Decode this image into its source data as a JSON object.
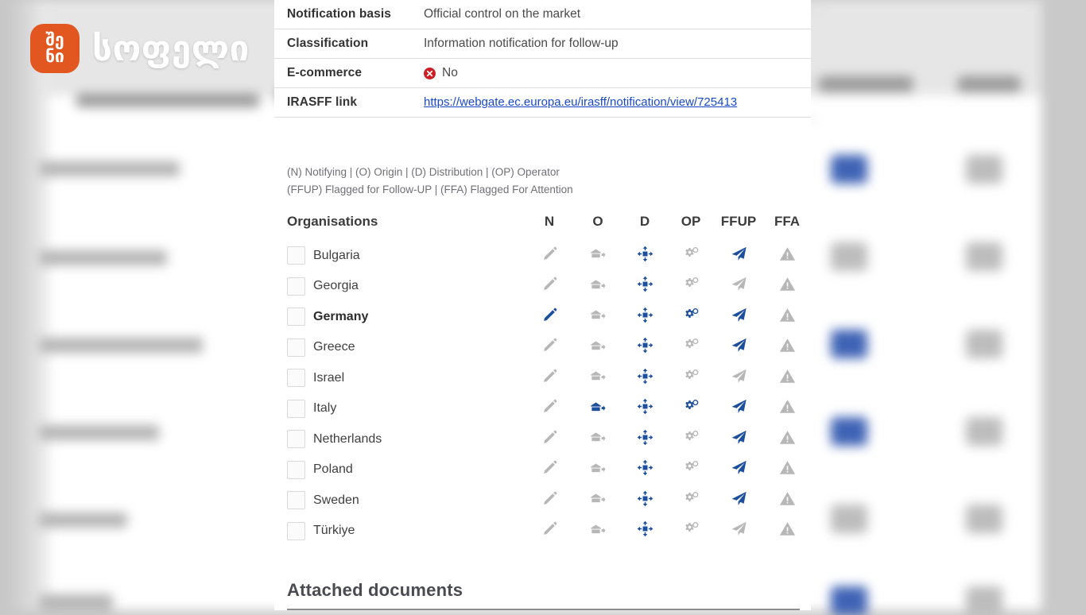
{
  "watermark": {
    "badge_line1": "შე",
    "badge_line2": "ნი",
    "wordmark": "სოფელი",
    "brand_color": "#e2561f"
  },
  "details": {
    "rows": [
      {
        "label": "Notification basis",
        "value": "Official control on the market",
        "type": "text"
      },
      {
        "label": "Classification",
        "value": "Information notification for follow-up",
        "type": "text"
      },
      {
        "label": "E-commerce",
        "value": "No",
        "type": "status-no",
        "status_color": "#cc1f26"
      },
      {
        "label": "IRASFF link",
        "value": "https://webgate.ec.europa.eu/irasff/notification/view/725413",
        "type": "link",
        "link_color": "#1749c9"
      }
    ]
  },
  "legend": {
    "line1": "(N) Notifying | (O) Origin | (D) Distribution | (OP) Operator",
    "line2": "(FFUP) Flagged for Follow-UP | (FFA) Flagged For Attention"
  },
  "organisations": {
    "headers": {
      "name": "Organisations",
      "n": "N",
      "o": "O",
      "d": "D",
      "op": "OP",
      "ffup": "FFUP",
      "ffa": "FFA"
    },
    "icon_names": {
      "n": "pencil-icon",
      "o": "warehouse-arrow-icon",
      "d": "distribution-spread-icon",
      "op": "gears-icon",
      "ffup": "paper-plane-icon",
      "ffa": "warning-triangle-icon"
    },
    "colors": {
      "active": "#1c4f9c",
      "inactive": "#b7b7b7",
      "inactive_light": "#cfcfcf"
    },
    "rows": [
      {
        "name": "Bulgaria",
        "bold": false,
        "checked": false,
        "n": "inactive",
        "o": "inactive",
        "d": "active",
        "op": "inactive",
        "ffup": "active",
        "ffa": "inactive"
      },
      {
        "name": "Georgia",
        "bold": false,
        "checked": false,
        "n": "inactive",
        "o": "inactive",
        "d": "active",
        "op": "inactive",
        "ffup": "inactive",
        "ffa": "inactive"
      },
      {
        "name": "Germany",
        "bold": true,
        "checked": false,
        "n": "active",
        "o": "inactive",
        "d": "active",
        "op": "active",
        "ffup": "active",
        "ffa": "inactive"
      },
      {
        "name": "Greece",
        "bold": false,
        "checked": false,
        "n": "inactive",
        "o": "inactive",
        "d": "active",
        "op": "inactive",
        "ffup": "active",
        "ffa": "inactive"
      },
      {
        "name": "Israel",
        "bold": false,
        "checked": false,
        "n": "inactive",
        "o": "inactive",
        "d": "active",
        "op": "inactive",
        "ffup": "inactive",
        "ffa": "inactive"
      },
      {
        "name": "Italy",
        "bold": false,
        "checked": false,
        "n": "inactive",
        "o": "active",
        "d": "active",
        "op": "active",
        "ffup": "active",
        "ffa": "inactive"
      },
      {
        "name": "Netherlands",
        "bold": false,
        "checked": false,
        "n": "inactive",
        "o": "inactive",
        "d": "active",
        "op": "inactive",
        "ffup": "active",
        "ffa": "inactive"
      },
      {
        "name": "Poland",
        "bold": false,
        "checked": false,
        "n": "inactive",
        "o": "inactive",
        "d": "active",
        "op": "inactive",
        "ffup": "active",
        "ffa": "inactive"
      },
      {
        "name": "Sweden",
        "bold": false,
        "checked": false,
        "n": "inactive",
        "o": "inactive",
        "d": "active",
        "op": "inactive",
        "ffup": "active",
        "ffa": "inactive"
      },
      {
        "name": "Türkiye",
        "bold": false,
        "checked": false,
        "n": "inactive",
        "o": "inactive",
        "d": "active",
        "op": "inactive",
        "ffup": "inactive",
        "ffa": "inactive"
      }
    ]
  },
  "attached": {
    "title": "Attached documents"
  }
}
